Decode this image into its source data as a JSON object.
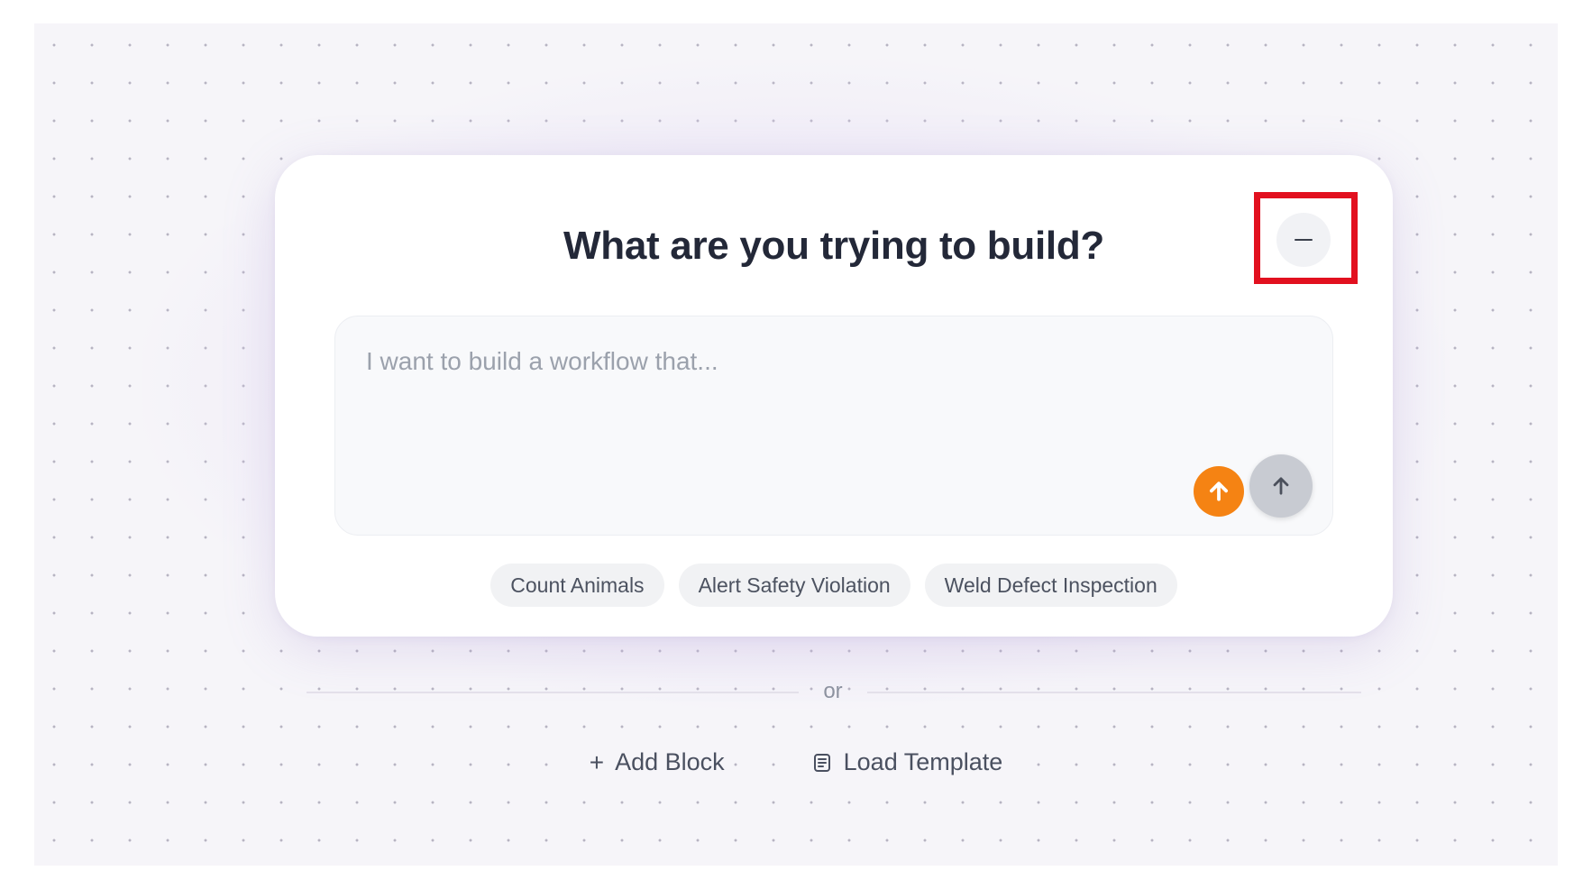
{
  "dialog": {
    "title": "What are you trying to build?",
    "minimize_icon": "minus-icon",
    "prompt_placeholder": "I want to build a workflow that...",
    "prompt_value": "",
    "upload_icon": "arrow-up-icon",
    "send_icon": "arrow-up-icon",
    "suggestions": [
      "Count Animals",
      "Alert Safety Violation",
      "Weld Defect Inspection"
    ]
  },
  "separator": {
    "label": "or"
  },
  "actions": {
    "add_block": {
      "icon": "plus-icon",
      "label": "Add Block"
    },
    "load_template": {
      "icon": "template-icon",
      "label": "Load Template"
    }
  },
  "colors": {
    "upload_button": "#f58313",
    "send_button": "#c8cbd2",
    "highlight_outline": "#e2101f"
  }
}
